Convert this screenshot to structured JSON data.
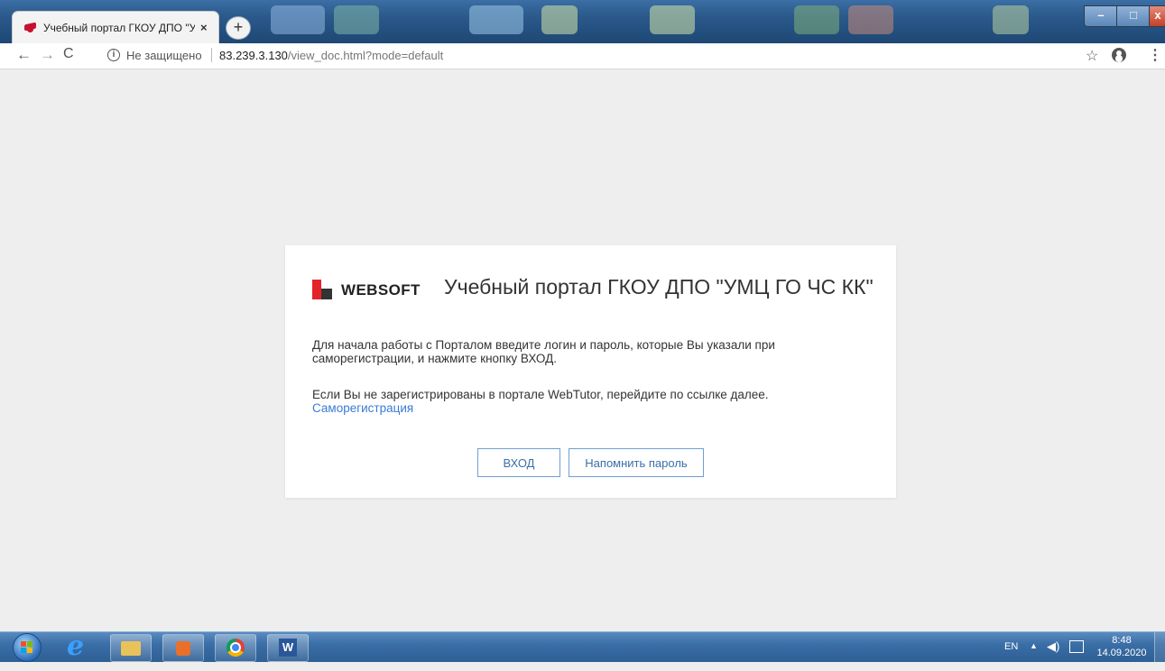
{
  "browser": {
    "tab_title": "Учебный портал ГКОУ ДПО \"УМ",
    "tab_close": "×",
    "new_tab": "+",
    "security_label": "Не защищено",
    "url_host": "83.239.3.130",
    "url_path": "/view_doc.html?mode=default",
    "info_glyph": "i",
    "star_glyph": "☆",
    "menu_glyph": "⋮",
    "back_glyph": "←",
    "forward_glyph": "→",
    "reload_glyph": "C",
    "win_min": "–",
    "win_max": "□",
    "win_close": "x"
  },
  "card": {
    "brand": "WEBSOFT",
    "heading": "Учебный портал ГКОУ ДПО \"УМЦ ГО ЧС КК\"",
    "paragraph1": "Для начала работы с Порталом введите логин и пароль, которые Вы указали при саморегистрации, и нажмите кнопку ВХОД.",
    "paragraph2": "Если Вы не зарегистрированы в портале WebTutor, перейдите по ссылке далее.",
    "link": "Саморегистрация",
    "login_button": "ВХОД",
    "remind_button": "Напомнить пароль"
  },
  "colors": {
    "accent": "#3a7bd5",
    "button_border": "#6e9fd3",
    "logo_red": "#e3242b",
    "page_bg": "#eeeeee"
  },
  "taskbar": {
    "ie_glyph": "e",
    "word_glyph": "W",
    "language": "EN",
    "tray_up": "▲",
    "volume_glyph": "◀)",
    "time": "8:48",
    "date": "14.09.2020"
  },
  "icons": [
    "chrome-favicon",
    "info-icon",
    "star-icon",
    "account-icon",
    "menu-icon",
    "websoft-logo-icon",
    "windows-start-icon",
    "ie-icon",
    "folder-icon",
    "media-player-icon",
    "chrome-icon",
    "word-icon",
    "volume-icon",
    "network-icon"
  ]
}
